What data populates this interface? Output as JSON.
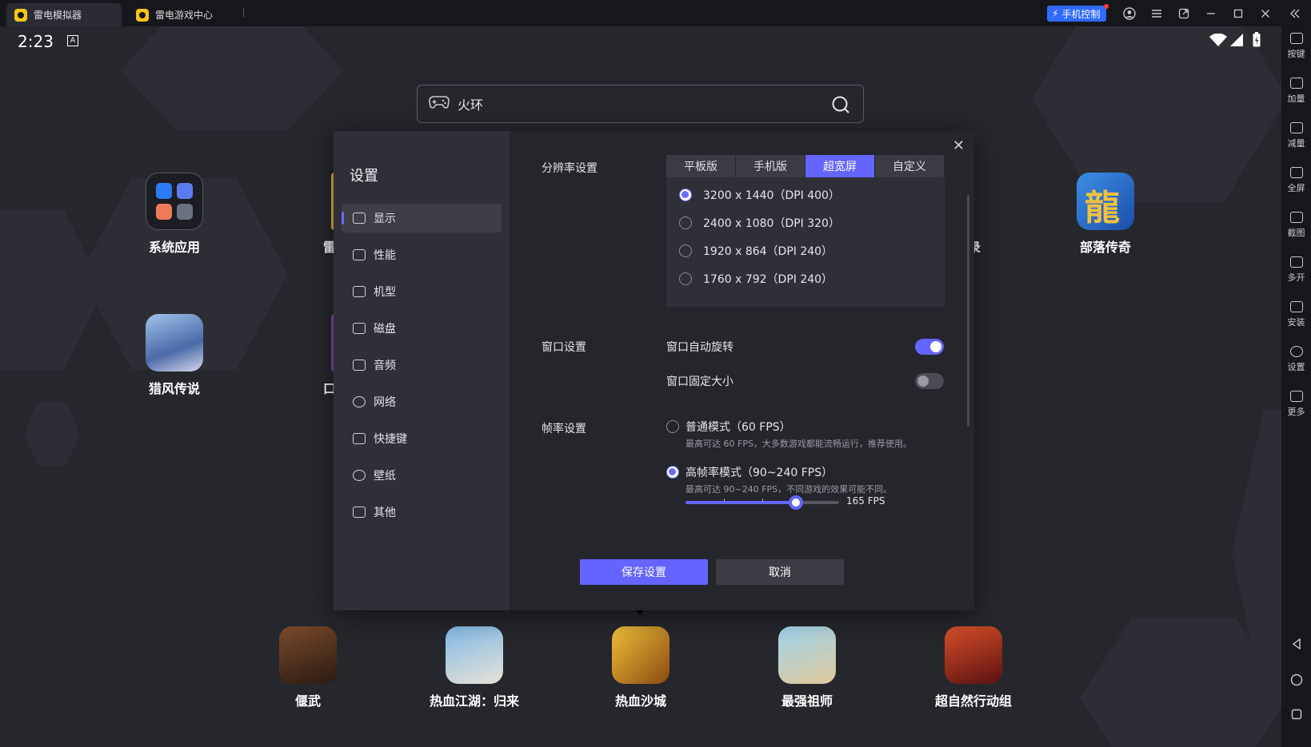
{
  "titlebar": {
    "tabs": [
      {
        "label": "雷电模拟器"
      },
      {
        "label": "雷电游戏中心"
      }
    ],
    "phone_control": "手机控制",
    "icons": [
      "user-icon",
      "menu-icon",
      "popout-icon",
      "minimize-icon",
      "maximize-icon",
      "close-icon",
      "collapse-icon"
    ]
  },
  "status": {
    "time": "2:23",
    "badge": "A"
  },
  "search": {
    "value": "火环"
  },
  "desktop": {
    "apps": [
      {
        "label": "系统应用"
      },
      {
        "label": "雷"
      },
      {
        "label": "部落传奇"
      },
      {
        "label": "猎风传说"
      },
      {
        "label": "口"
      },
      {
        "label": "录"
      }
    ],
    "dock": [
      {
        "label": "偃武"
      },
      {
        "label": "热血江湖：归来"
      },
      {
        "label": "热血沙城"
      },
      {
        "label": "最强祖师"
      },
      {
        "label": "超自然行动组"
      }
    ]
  },
  "sidebar_right": {
    "buttons": [
      {
        "label": "按键"
      },
      {
        "label": "加量"
      },
      {
        "label": "减量"
      },
      {
        "label": "全屏"
      },
      {
        "label": "截图"
      },
      {
        "label": "多开"
      },
      {
        "label": "安装"
      },
      {
        "label": "设置"
      },
      {
        "label": "更多"
      }
    ]
  },
  "settings": {
    "title": "设置",
    "nav": [
      {
        "label": "显示"
      },
      {
        "label": "性能"
      },
      {
        "label": "机型"
      },
      {
        "label": "磁盘"
      },
      {
        "label": "音频"
      },
      {
        "label": "网络"
      },
      {
        "label": "快捷键"
      },
      {
        "label": "壁纸"
      },
      {
        "label": "其他"
      }
    ],
    "resolution": {
      "label": "分辨率设置",
      "tabs": [
        {
          "label": "平板版"
        },
        {
          "label": "手机版"
        },
        {
          "label": "超宽屏"
        },
        {
          "label": "自定义"
        }
      ],
      "options": [
        {
          "label": "3200 x 1440（DPI 400）"
        },
        {
          "label": "2400 x 1080（DPI 320）"
        },
        {
          "label": "1920 x 864（DPI 240）"
        },
        {
          "label": "1760 x 792（DPI 240）"
        }
      ]
    },
    "window": {
      "label": "窗口设置",
      "auto_rotate": "窗口自动旋转",
      "fixed_size": "窗口固定大小"
    },
    "fps": {
      "label": "帧率设置",
      "normal": "普通模式（60 FPS）",
      "normal_desc": "最高可达 60 FPS，大多数游戏都能流畅运行，推荐使用。",
      "high": "高帧率模式（90~240 FPS）",
      "high_desc": "最高可达 90~240 FPS，不同游戏的效果可能不同。",
      "value": "165 FPS",
      "slider_fraction": 0.72
    },
    "save": "保存设置",
    "cancel": "取消"
  }
}
